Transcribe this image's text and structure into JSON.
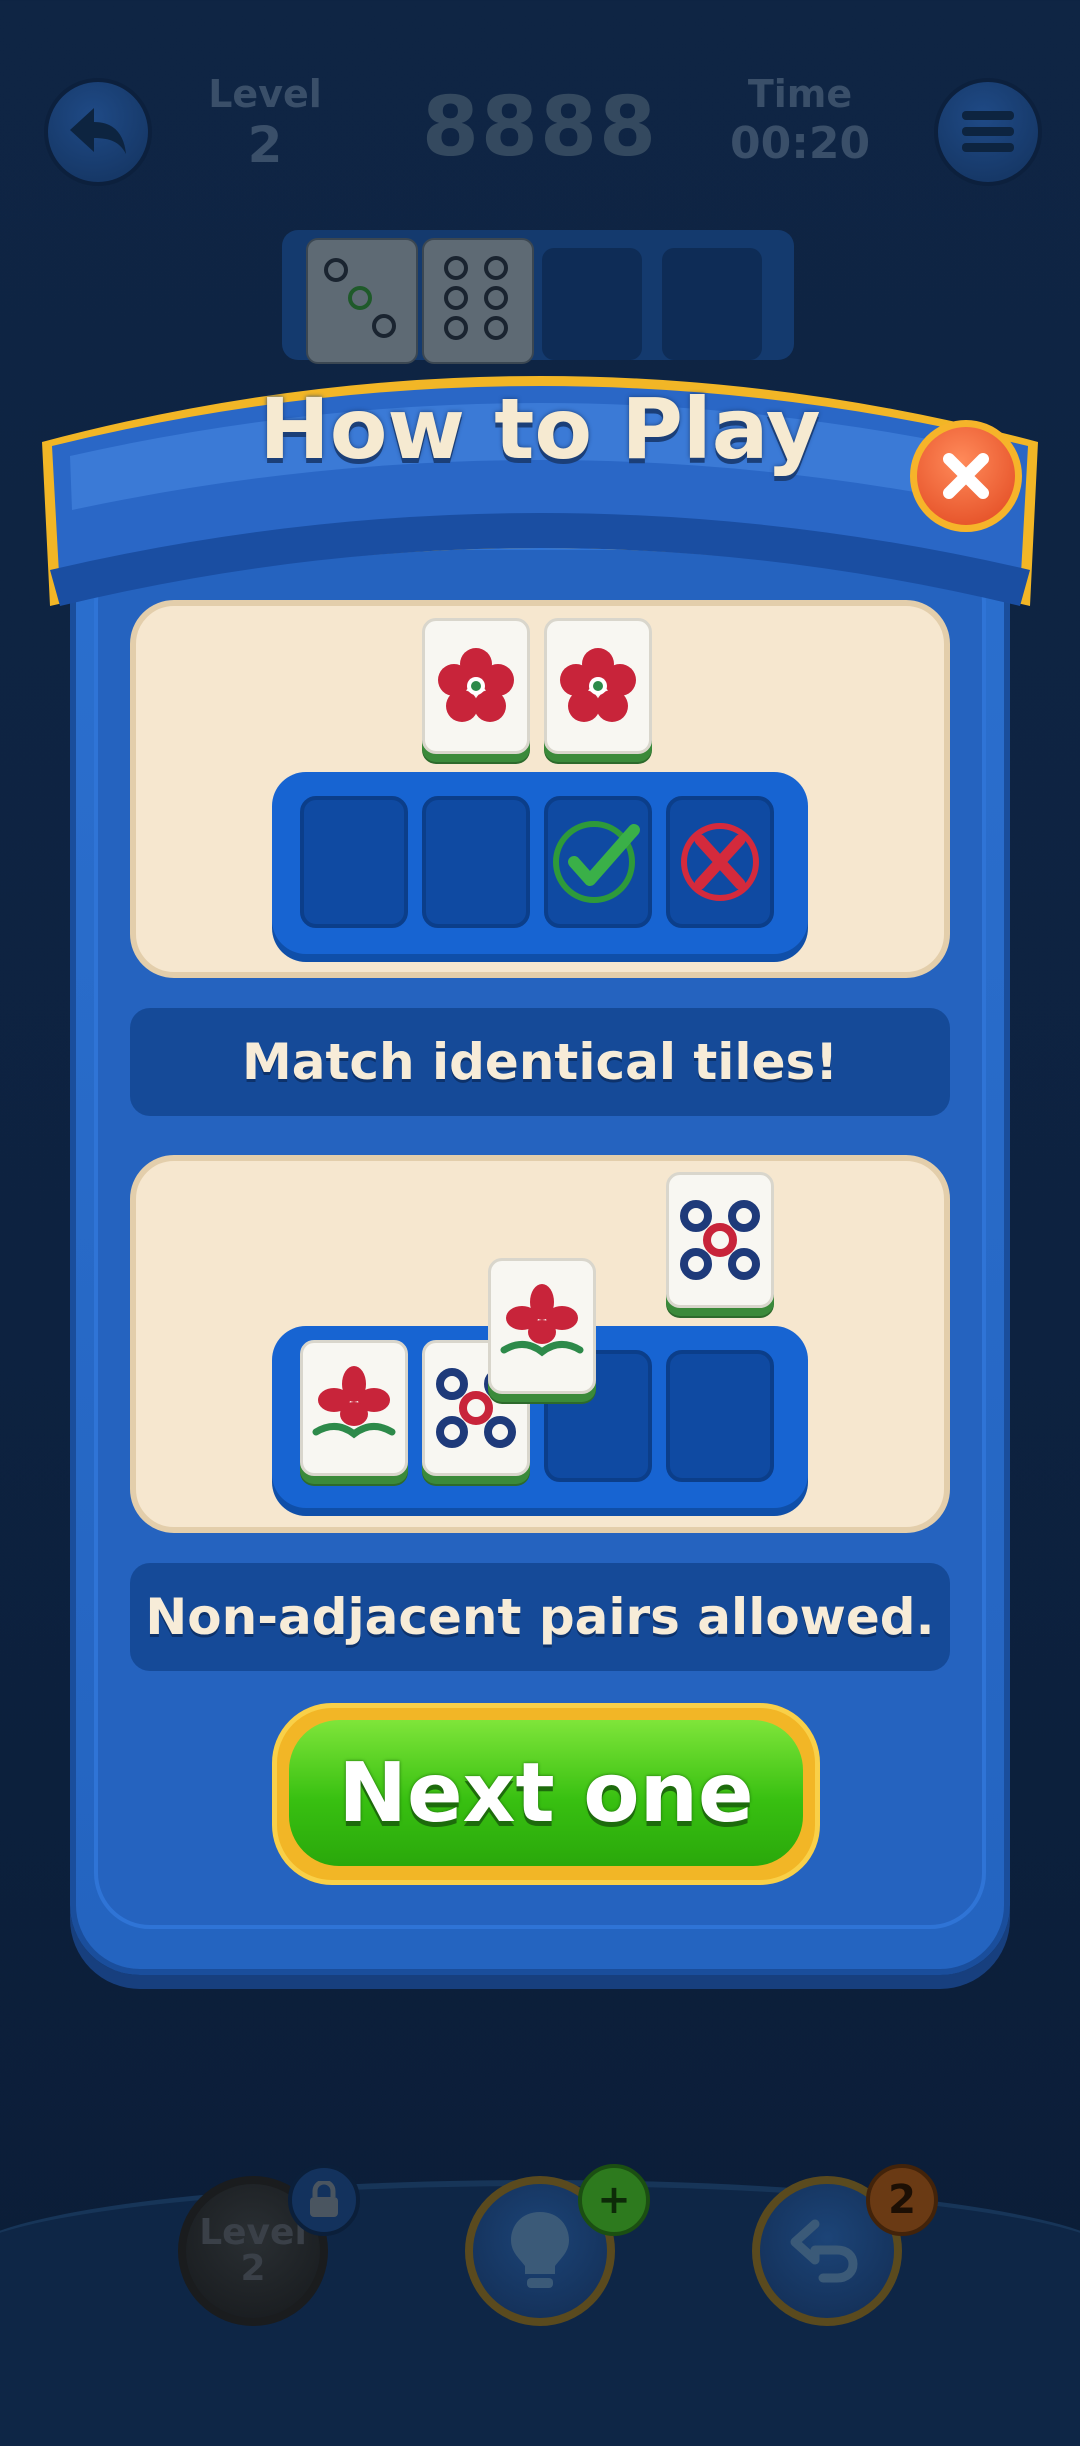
{
  "header": {
    "level_label": "Level",
    "level_value": "2",
    "score": "8888",
    "time_label": "Time",
    "time_value": "00:20"
  },
  "dialog": {
    "title": "How to Play",
    "step1_caption": "Match identical tiles!",
    "step2_caption": "Non-adjacent pairs allowed.",
    "next_label": "Next one"
  },
  "bottom_bar": {
    "level_label": "Level",
    "level_value": "2",
    "hint_badge": "+",
    "undo_count": "2"
  },
  "icons": [
    "back-arrow-icon",
    "menu-icon",
    "close-icon",
    "check-icon",
    "cross-icon",
    "lock-icon",
    "lightbulb-icon",
    "undo-icon",
    "plus-icon"
  ],
  "colors": {
    "background": "#0f2544",
    "dialog_blue": "#2563bf",
    "panel_cream": "#f6e7cf",
    "next_green": "#38c011",
    "gold_border": "#f2b626",
    "close_orange": "#e0461e"
  }
}
